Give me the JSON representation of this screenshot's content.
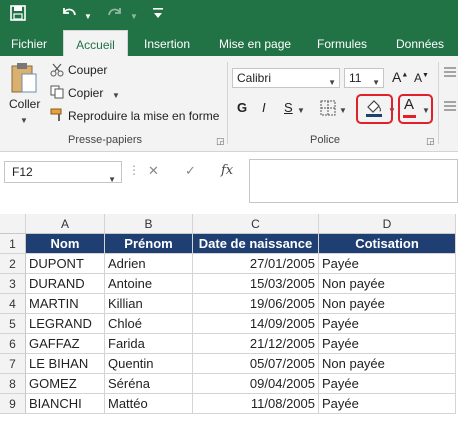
{
  "quick_access": {
    "save": "save-icon",
    "undo": "undo-icon",
    "redo": "redo-icon"
  },
  "tabs": [
    {
      "label": "Fichier"
    },
    {
      "label": "Accueil"
    },
    {
      "label": "Insertion"
    },
    {
      "label": "Mise en page"
    },
    {
      "label": "Formules"
    },
    {
      "label": "Données"
    }
  ],
  "clipboard": {
    "paste_label": "Coller",
    "cut_label": "Couper",
    "copy_label": "Copier",
    "format_painter_label": "Reproduire la mise en forme",
    "group_label": "Presse-papiers"
  },
  "font": {
    "font_name": "Calibri",
    "font_size": "11",
    "bold": "G",
    "italic": "I",
    "underline": "S",
    "grow": "A",
    "shrink": "A",
    "font_color_letter": "A",
    "group_label": "Police"
  },
  "formula_bar": {
    "name_box": "F12",
    "fx": "fx",
    "cancel": "✕",
    "enter": "✓"
  },
  "colors": {
    "fill_accent": "#1f3f73",
    "font_color_accent": "#e0202a",
    "excel_green": "#217346",
    "highlight": "#e0202a"
  },
  "sheet": {
    "columns": [
      "A",
      "B",
      "C",
      "D"
    ],
    "rows": [
      [
        "Nom",
        "Prénom",
        "Date de naissance",
        "Cotisation"
      ],
      [
        "DUPONT",
        "Adrien",
        "27/01/2005",
        "Payée"
      ],
      [
        "DURAND",
        "Antoine",
        "15/03/2005",
        "Non payée"
      ],
      [
        "MARTIN",
        "Killian",
        "19/06/2005",
        "Non payée"
      ],
      [
        "LEGRAND",
        "Chloé",
        "14/09/2005",
        "Payée"
      ],
      [
        "GAFFAZ",
        "Farida",
        "21/12/2005",
        "Payée"
      ],
      [
        "LE BIHAN",
        "Quentin",
        "05/07/2005",
        "Non payée"
      ],
      [
        "GOMEZ",
        "Séréna",
        "09/04/2005",
        "Payée"
      ],
      [
        "BIANCHI",
        "Mattéo",
        "11/08/2005",
        "Payée"
      ]
    ]
  }
}
